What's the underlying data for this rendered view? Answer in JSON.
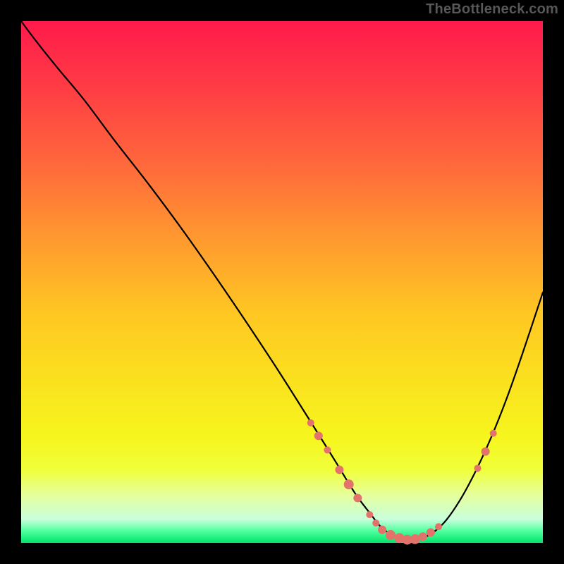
{
  "watermark": "TheBottleneck.com",
  "colors": {
    "background": "#000000",
    "curve": "#000000",
    "dots": "#e2726a"
  },
  "chart_data": {
    "type": "line",
    "title": "",
    "xlabel": "",
    "ylabel": "",
    "xlim": [
      0,
      100
    ],
    "ylim": [
      0,
      100
    ],
    "grid": false,
    "legend": false,
    "series": [
      {
        "name": "curve",
        "x": [
          0,
          3,
          7,
          12,
          18,
          25,
          32,
          40,
          48,
          55,
          60,
          64,
          67,
          69,
          71,
          73,
          75,
          78,
          81,
          84,
          87,
          90,
          93,
          96,
          100
        ],
        "y": [
          100,
          96,
          91,
          85,
          77,
          68,
          58.5,
          47,
          35,
          24,
          16,
          9.5,
          5.5,
          3,
          1.6,
          0.8,
          0.6,
          1.4,
          3.8,
          8,
          13.5,
          20,
          27.5,
          36,
          48
        ]
      }
    ],
    "scatter_points": [
      {
        "x": 55.5,
        "y": 23,
        "r": 5
      },
      {
        "x": 57.0,
        "y": 20.5,
        "r": 6
      },
      {
        "x": 58.7,
        "y": 17.8,
        "r": 5
      },
      {
        "x": 61.0,
        "y": 14.0,
        "r": 6
      },
      {
        "x": 62.8,
        "y": 11.2,
        "r": 7
      },
      {
        "x": 64.5,
        "y": 8.6,
        "r": 6
      },
      {
        "x": 66.8,
        "y": 5.4,
        "r": 5
      },
      {
        "x": 68.0,
        "y": 3.8,
        "r": 5
      },
      {
        "x": 69.2,
        "y": 2.5,
        "r": 6
      },
      {
        "x": 70.8,
        "y": 1.5,
        "r": 7
      },
      {
        "x": 72.5,
        "y": 0.9,
        "r": 7
      },
      {
        "x": 74.0,
        "y": 0.6,
        "r": 7
      },
      {
        "x": 75.5,
        "y": 0.7,
        "r": 7
      },
      {
        "x": 77.0,
        "y": 1.2,
        "r": 6
      },
      {
        "x": 78.5,
        "y": 2.0,
        "r": 6
      },
      {
        "x": 80.0,
        "y": 3.1,
        "r": 5
      },
      {
        "x": 87.5,
        "y": 14.3,
        "r": 5
      },
      {
        "x": 89.0,
        "y": 17.5,
        "r": 6
      },
      {
        "x": 90.5,
        "y": 21.0,
        "r": 5
      }
    ]
  }
}
